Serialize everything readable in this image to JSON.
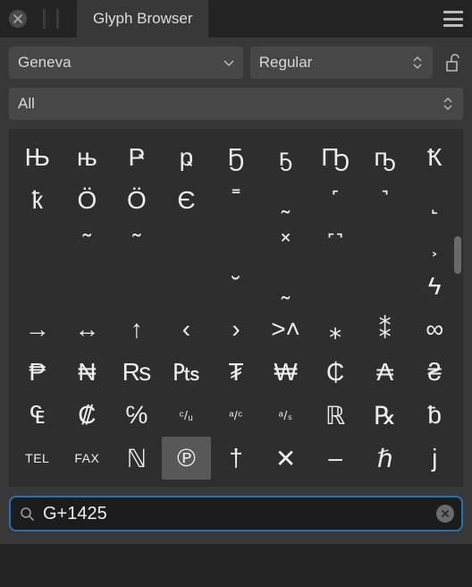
{
  "panel": {
    "title": "Glyph Browser"
  },
  "font_select": {
    "value": "Geneva"
  },
  "style_select": {
    "value": "Regular"
  },
  "category_select": {
    "value": "All"
  },
  "search": {
    "value": "G+1425"
  },
  "glyph_grid": {
    "columns": 9,
    "selected_index": 66,
    "glyphs": [
      "Њ",
      "њ",
      "Ҏ",
      "ҏ",
      "Ҕ",
      "ҕ",
      "Ҧ",
      "ҧ",
      "Ҟ",
      "ҟ",
      "Ӧ",
      "Ӧ",
      "Є",
      "˭",
      "˷",
      "˹",
      "˺",
      "˻",
      "",
      "˜",
      "˜",
      "",
      "",
      "˟",
      "˹˺",
      "",
      "˲",
      "",
      "",
      "",
      "",
      "˘",
      "˷",
      "",
      "",
      "ϟ",
      "→",
      "↔",
      "↑",
      "‹",
      "›",
      "˃˄",
      "⁎",
      "⁑",
      "∞",
      "₱",
      "₦",
      "₨",
      "₧",
      "₮",
      "₩",
      "₵",
      "₳",
      "₴",
      "₠",
      "₡",
      "℅",
      "ᶜ/ᵤ",
      "ᵃ/ᶜ",
      "ᵃ/ₛ",
      "ℝ",
      "℞",
      "ƀ",
      "TEL",
      "FAX",
      "ℕ",
      "℗",
      "†",
      "✕",
      "–",
      "ℏ",
      "j"
    ]
  }
}
